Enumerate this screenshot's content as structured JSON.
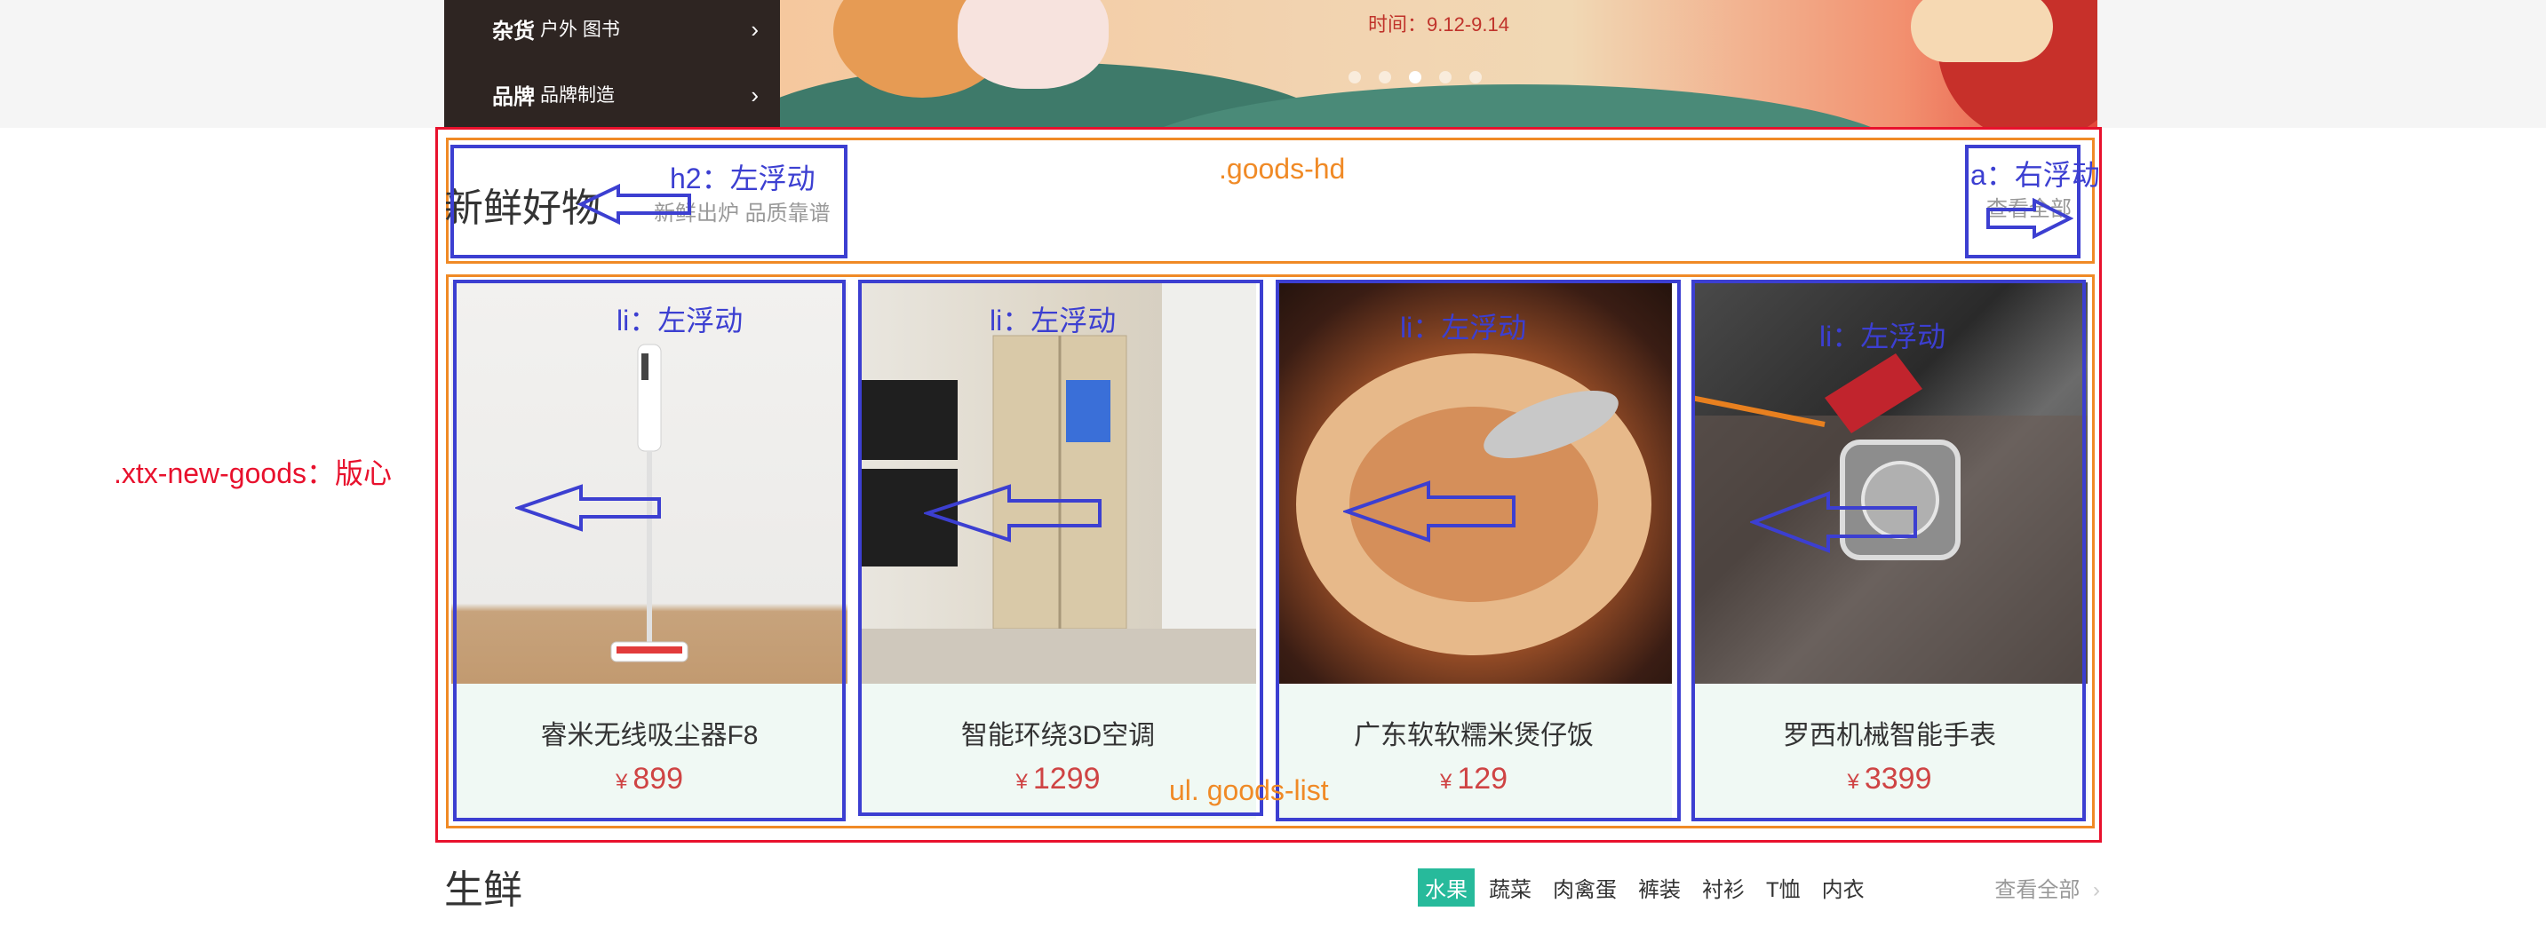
{
  "category_nav": [
    {
      "main": "杂货",
      "sub": "户外 图书",
      "chevron": "›"
    },
    {
      "main": "品牌",
      "sub": "品牌制造",
      "chevron": "›"
    }
  ],
  "banner": {
    "date_text": "时间：9.12-9.14",
    "dots": 5,
    "active_dot": 3
  },
  "annotations": {
    "goods_hd": ".goods-hd",
    "h2_float": "h2：左浮动",
    "a_float": "a：右浮动",
    "li_float": "li：左浮动",
    "ul_goods_list": "ul. goods-list",
    "container": ".xtx-new-goods：版心"
  },
  "new_goods": {
    "title": "新鲜好物",
    "subtitle": "新鲜出炉 品质靠谱",
    "view_all": "查看全部",
    "items": [
      {
        "name": "睿米无线吸尘器F8",
        "currency": "¥",
        "price": "899"
      },
      {
        "name": "智能环绕3D空调",
        "currency": "¥",
        "price": "1299"
      },
      {
        "name": "广东软软糯米煲仔饭",
        "currency": "¥",
        "price": "129"
      },
      {
        "name": "罗西机械智能手表",
        "currency": "¥",
        "price": "3399"
      }
    ]
  },
  "fresh_section": {
    "title": "生鲜",
    "tabs": [
      "水果",
      "蔬菜",
      "肉禽蛋",
      "裤装",
      "衬衫",
      "T恤",
      "内衣"
    ],
    "active_tab": "水果",
    "view_all": "查看全部",
    "chevron": "›"
  },
  "colors": {
    "annotation_red": "#e8112d",
    "annotation_orange": "#f08a26",
    "annotation_blue": "#3c3fd1",
    "price": "#cf4444",
    "card_info_bg": "#f0f9f4",
    "tab_active": "#27ba9b"
  }
}
